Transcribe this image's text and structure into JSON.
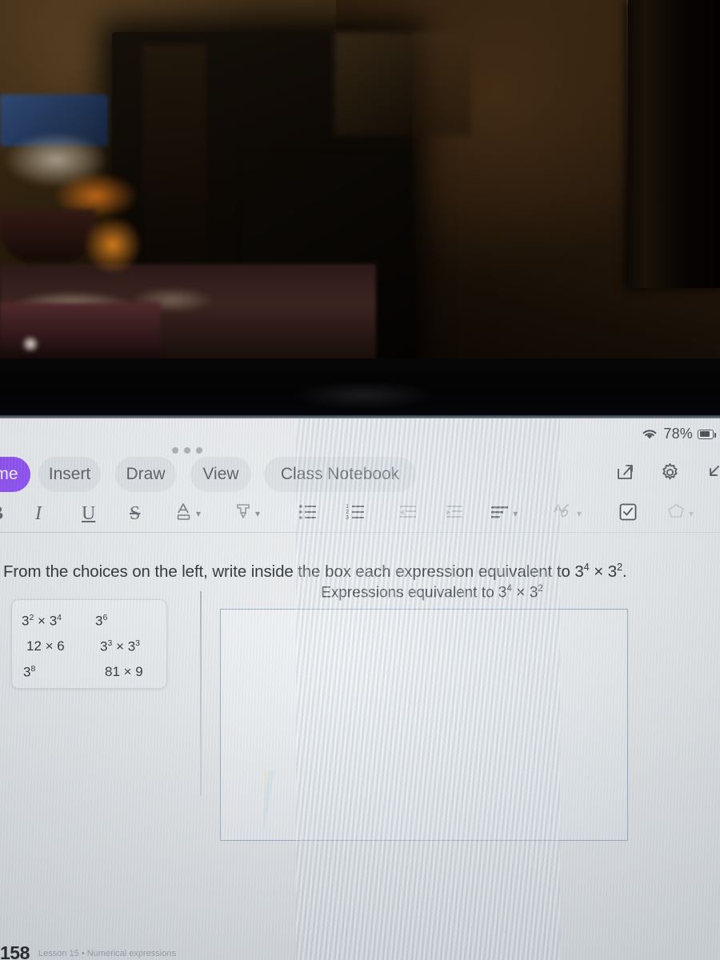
{
  "photo": {
    "scene_description": "dark dim room with cabinet and countertop items behind a laptop screen"
  },
  "status_bar": {
    "wifi_icon": "wifi-icon",
    "battery_percent": "78%",
    "battery_icon": "battery-icon",
    "grabber_icon": "three-dot-grabber-icon"
  },
  "ribbon": {
    "tabs": [
      {
        "label": "me",
        "name": "tab-home",
        "active": true
      },
      {
        "label": "Insert",
        "name": "tab-insert",
        "active": false
      },
      {
        "label": "Draw",
        "name": "tab-draw",
        "active": false
      },
      {
        "label": "View",
        "name": "tab-view",
        "active": false
      },
      {
        "label": "Class Notebook",
        "name": "tab-class-notebook",
        "active": false
      }
    ],
    "actions": [
      {
        "name": "share-icon",
        "label": "Share"
      },
      {
        "name": "gear-icon",
        "label": "Settings"
      },
      {
        "name": "collapse-ribbon-icon",
        "label": "Collapse"
      }
    ]
  },
  "format_toolbar": {
    "items": [
      {
        "name": "bold-button",
        "glyph": "B"
      },
      {
        "name": "italic-button",
        "glyph": "I"
      },
      {
        "name": "underline-button",
        "glyph": "U"
      },
      {
        "name": "strikethrough-button",
        "glyph": "S"
      },
      {
        "name": "font-color-button",
        "glyph": "A"
      },
      {
        "name": "highlight-button",
        "glyph": "highlighter"
      },
      {
        "name": "bulleted-list-button",
        "glyph": "bullets"
      },
      {
        "name": "numbered-list-button",
        "glyph": "numbers"
      },
      {
        "name": "decrease-indent-button",
        "glyph": "outdent"
      },
      {
        "name": "increase-indent-button",
        "glyph": "indent"
      },
      {
        "name": "align-button",
        "glyph": "align"
      },
      {
        "name": "ink-to-text-button",
        "glyph": "ink"
      },
      {
        "name": "todo-checkbox-button",
        "glyph": "checkbox"
      },
      {
        "name": "tag-button",
        "glyph": "tag"
      }
    ]
  },
  "page": {
    "instruction_parts": {
      "before": "From the choices on the left, write inside the box each expression equivalent to 3",
      "exp1": "4",
      "middle": " × 3",
      "exp2": "2",
      "after": "."
    },
    "choices": [
      {
        "left_base": "3",
        "left_exp": "2",
        "left_op": " × 3",
        "left_exp2": "4",
        "right_base": "3",
        "right_exp": "6",
        "right_plain": ""
      },
      {
        "left_plain": "12 × 6",
        "right_base": "3",
        "right_exp": "3",
        "right_op": " × 3",
        "right_exp2": "3"
      },
      {
        "left_base": "3",
        "left_exp": "8",
        "right_plain": "81 × 9"
      }
    ],
    "answer_header_parts": {
      "before": "Expressions equivalent to 3",
      "exp1": "4",
      "middle": " × 3",
      "exp2": "2"
    },
    "answer_box_content": "",
    "page_number": "158",
    "footnote": "Lesson 15 • Numerical expressions"
  },
  "colors": {
    "accent_purple": "#8a3ffc",
    "answer_box_border": "#8fa7c4",
    "text": "#16181a",
    "icon_gray": "#53585f"
  }
}
